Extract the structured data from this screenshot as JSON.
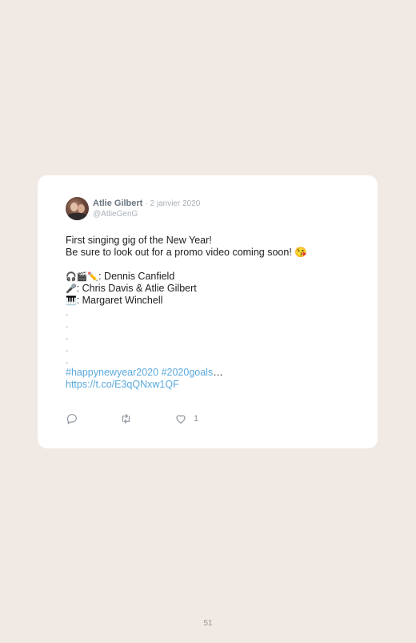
{
  "tweet": {
    "author_name": "Atlie Gilbert",
    "date": "· 2 janvier 2020",
    "handle": "@AtlieGenG",
    "line1": "First singing gig of the New Year!",
    "line2": "Be sure to look out for a promo video coming soon! 😘",
    "credit1_emoji": "🎧🎬✏️",
    "credit1_text": ": Dennis Canfield",
    "credit2_emoji": "🎤",
    "credit2_text": ": Chris Davis & Atlie Gilbert",
    "credit3_emoji": "🎹",
    "credit3_text": ": Margaret Winchell",
    "dots": [
      ".",
      ".",
      ".",
      ".",
      "."
    ],
    "hashtag1": "#happynewyear2020",
    "hashtag2": "#2020goals",
    "ellipsis": "…",
    "link": "https://t.co/E3qQNxw1QF",
    "like_count": "1"
  },
  "icons": {
    "reply": "reply-icon",
    "retweet": "retweet-icon",
    "like": "heart-icon"
  },
  "colors": {
    "background": "#f1e9e4",
    "card": "#ffffff",
    "link": "#5aa9dd",
    "muted": "#a9b0b7"
  },
  "page_number": "51"
}
